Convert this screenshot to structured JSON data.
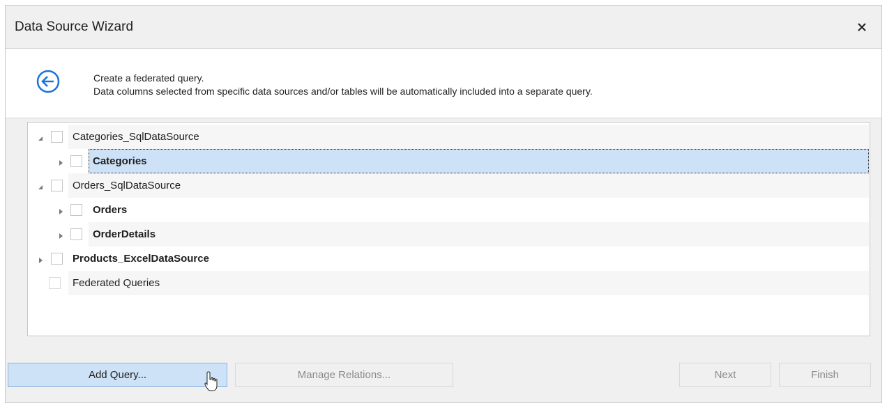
{
  "window": {
    "title": "Data Source Wizard"
  },
  "header": {
    "line1": "Create a federated query.",
    "line2": "Data columns selected from specific data sources and/or tables will be automatically included into a separate query."
  },
  "tree": {
    "rows": [
      {
        "label": "Categories_SqlDataSource",
        "expanded": true,
        "bold": false
      },
      {
        "label": "Categories",
        "expanded": false,
        "bold": true,
        "selected": true
      },
      {
        "label": "Orders_SqlDataSource",
        "expanded": true,
        "bold": false
      },
      {
        "label": "Orders",
        "expanded": false,
        "bold": true
      },
      {
        "label": "OrderDetails",
        "expanded": false,
        "bold": true
      },
      {
        "label": "Products_ExcelDataSource",
        "expanded": false,
        "bold": true
      },
      {
        "label": "Federated Queries",
        "bold": false
      }
    ]
  },
  "buttons": {
    "add_query": "Add Query...",
    "manage_relations": "Manage Relations...",
    "next": "Next",
    "finish": "Finish"
  },
  "colors": {
    "accent": "#1a73d9",
    "selection": "#cde1f7"
  }
}
